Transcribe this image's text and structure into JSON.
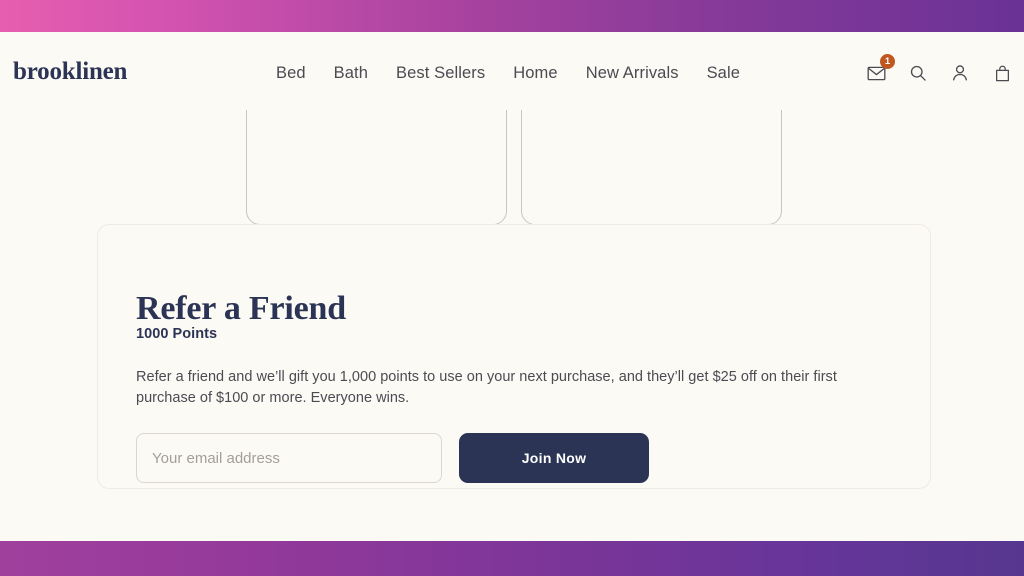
{
  "chrome": {
    "top_band_color_start": "#E75EAF",
    "top_band_color_end": "#6A3296",
    "bottom_band_color_start": "#A0409D",
    "bottom_band_color_end": "#56378F"
  },
  "header": {
    "logo_text": "brooklinen",
    "nav_items": [
      {
        "label": "Bed"
      },
      {
        "label": "Bath"
      },
      {
        "label": "Best Sellers"
      },
      {
        "label": "Home"
      },
      {
        "label": "New Arrivals"
      },
      {
        "label": "Sale"
      }
    ],
    "icons": [
      {
        "name": "envelope-icon",
        "badge_count": "1",
        "badge_color": "#C0571F"
      },
      {
        "name": "search-icon"
      },
      {
        "name": "account-icon"
      },
      {
        "name": "shopping-bag-icon"
      }
    ]
  },
  "refer_card": {
    "title": "Refer a Friend",
    "points_label": "1000 Points",
    "description": "Refer a friend and we’ll gift you 1,000 points to use on your next purchase, and they’ll get $25 off on their first purchase of $100 or more. Everyone wins.",
    "email_placeholder": "Your email address",
    "email_value": "",
    "submit_label": "Join Now",
    "accent_color": "#2B3455"
  },
  "theme": {
    "page_background": "#FCFAF5",
    "navy": "#2B3455",
    "body_text": "#4B4B52",
    "card_border": "#F0EBE3",
    "tile_border": "#C9C4BE"
  }
}
